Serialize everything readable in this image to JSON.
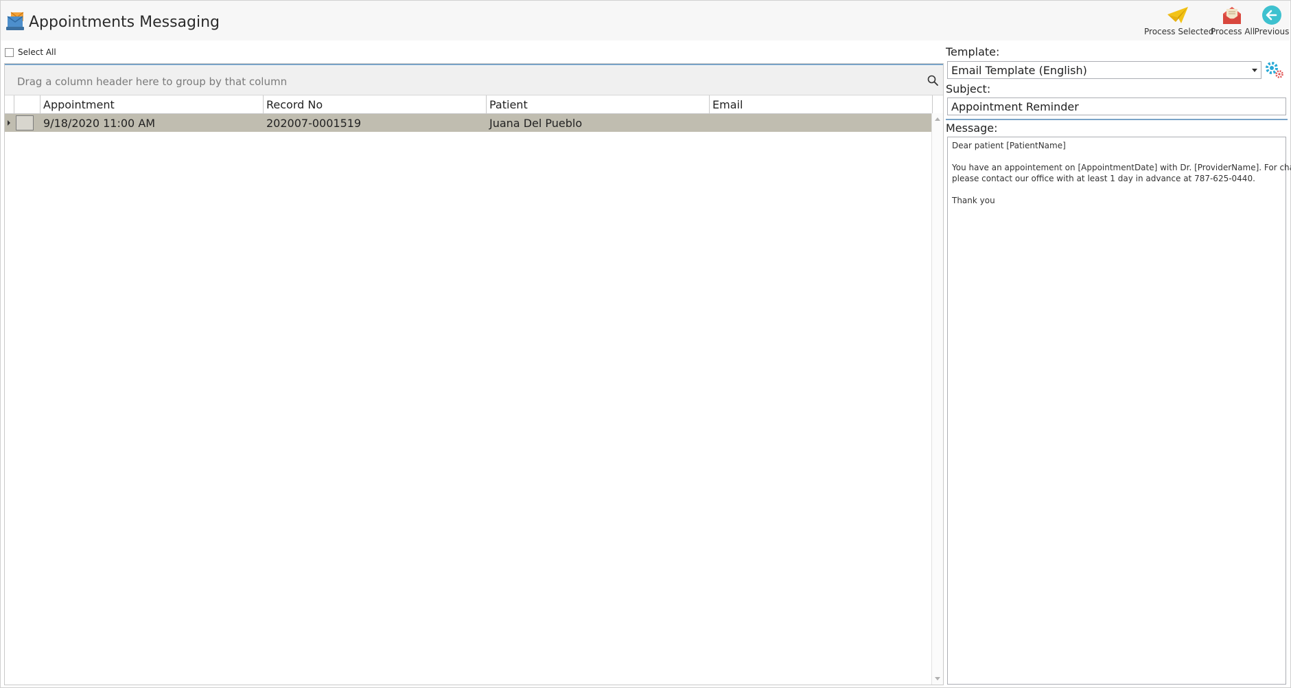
{
  "header": {
    "title": "Appointments Messaging",
    "app_icon": "envelopes-icon",
    "toolbar": [
      {
        "label": "Process Selected",
        "icon": "paper-plane-icon"
      },
      {
        "label": "Process All",
        "icon": "envelope-open-icon"
      },
      {
        "label": "Previous",
        "icon": "back-arrow-icon"
      }
    ]
  },
  "select_all": {
    "label": "Select All",
    "checked": false
  },
  "grid": {
    "group_panel_text": "Drag a column header here to group by that column",
    "columns": [
      "Appointment",
      "Record No",
      "Patient",
      "Email"
    ],
    "rows": [
      {
        "appointment": "9/18/2020 11:00 AM",
        "record_no": "202007-0001519",
        "patient": "Juana Del Pueblo",
        "email": "",
        "selected": true
      }
    ]
  },
  "right_panel": {
    "template_label": "Template:",
    "template_value": "Email Template (English)",
    "subject_label": "Subject:",
    "subject_value": "Appointment Reminder",
    "message_label": "Message:",
    "message_lines": [
      "Dear patient [PatientName]",
      "",
      "You have an appointement on [AppointmentDate] with Dr. [ProviderName]. For changes",
      "please contact our office with at least 1 day in advance at 787-625-0440.",
      "",
      "Thank you"
    ]
  },
  "colors": {
    "selected_row": "#c0bdb0",
    "accent_blue": "#7aa3c7",
    "header_bg": "#f7f7f7"
  }
}
